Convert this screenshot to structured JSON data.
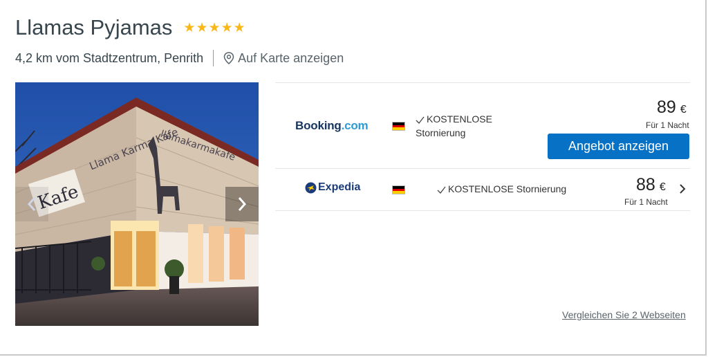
{
  "hotel": {
    "name": "Llamas Pyjamas",
    "rating_stars": 5,
    "distance": "4,2 km vom Stadtzentrum, Penrith",
    "map_link": "Auf Karte anzeigen"
  },
  "photo": {
    "sign_text_1": "Kafe",
    "sign_text_2": "Llama Karma Kafe",
    "sign_text_3": "llamakarmakafe"
  },
  "deals": [
    {
      "provider": "Booking.com",
      "provider_main": "Booking",
      "provider_suffix": ".com",
      "cancellation_line1": "KOSTENLOSE",
      "cancellation_line2": "Stornierung",
      "price": "89",
      "currency": "€",
      "per_night": "Für 1 Nacht",
      "cta": "Angebot anzeigen"
    },
    {
      "provider": "Expedia",
      "cancellation": "KOSTENLOSE Stornierung",
      "price": "88",
      "currency": "€",
      "per_night": "Für 1 Nacht"
    }
  ],
  "compare_link": "Vergleichen Sie 2 Webseiten",
  "colors": {
    "star": "#f9b71a",
    "cta_bg": "#0771c6",
    "title": "#37454d",
    "flag_black": "#000000",
    "flag_red": "#dd0000",
    "flag_gold": "#ffce00"
  }
}
